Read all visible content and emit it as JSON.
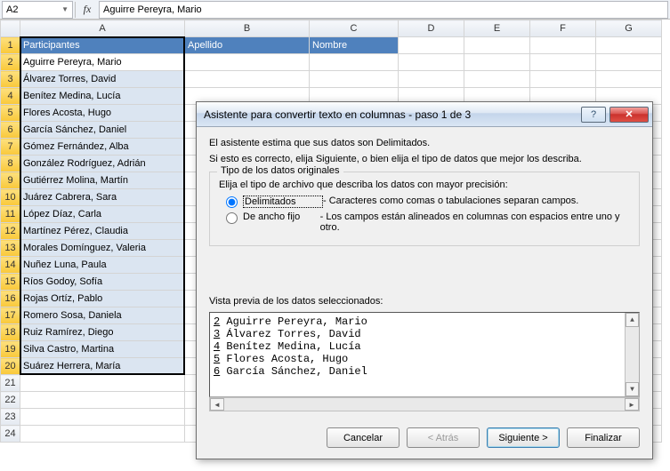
{
  "formula_bar": {
    "cell_ref": "A2",
    "fx_label": "fx",
    "value": "Aguirre Pereyra, Mario"
  },
  "columns": [
    "A",
    "B",
    "C",
    "D",
    "E",
    "F",
    "G"
  ],
  "header_row": {
    "A": "Participantes",
    "B": "Apellido",
    "C": "Nombre"
  },
  "data_rows": [
    "Aguirre Pereyra, Mario",
    "Álvarez Torres, David",
    "Benítez Medina, Lucía",
    "Flores Acosta, Hugo",
    "García Sánchez, Daniel",
    "Gómez Fernández, Alba",
    "González Rodríguez, Adrián",
    "Gutiérrez Molina, Martín",
    "Juárez Cabrera, Sara",
    "López Díaz, Carla",
    "Martínez Pérez, Claudia",
    "Morales Domínguez, Valeria",
    "Nuñez Luna, Paula",
    "Ríos Godoy, Sofía",
    "Rojas Ortíz, Pablo",
    "Romero Sosa, Daniela",
    "Ruiz Ramírez, Diego",
    "Silva Castro, Martina",
    "Suárez Herrera, María"
  ],
  "row_count_visible": 24,
  "dialog": {
    "title": "Asistente para convertir texto en columnas - paso 1 de 3",
    "intro1": "El asistente estima que sus datos son Delimitados.",
    "intro2": "Si esto es correcto, elija Siguiente, o bien elija el tipo de datos que mejor los describa.",
    "group_title": "Tipo de los datos originales",
    "group_prompt": "Elija el tipo de archivo que describa los datos con mayor precisión:",
    "radio1_label": "Delimitados",
    "radio1_desc": "- Caracteres como comas o tabulaciones separan campos.",
    "radio2_label": "De ancho fijo",
    "radio2_desc": "- Los campos están alineados en columnas con espacios entre uno y otro.",
    "preview_label": "Vista previa de los datos seleccionados:",
    "preview_lines": [
      {
        "n": "2",
        "t": "Aguirre Pereyra, Mario"
      },
      {
        "n": "3",
        "t": "Álvarez Torres, David"
      },
      {
        "n": "4",
        "t": "Benítez Medina, Lucía"
      },
      {
        "n": "5",
        "t": "Flores Acosta, Hugo"
      },
      {
        "n": "6",
        "t": "García Sánchez, Daniel"
      }
    ],
    "buttons": {
      "cancel": "Cancelar",
      "back": "< Atrás",
      "next": "Siguiente >",
      "finish": "Finalizar"
    }
  }
}
